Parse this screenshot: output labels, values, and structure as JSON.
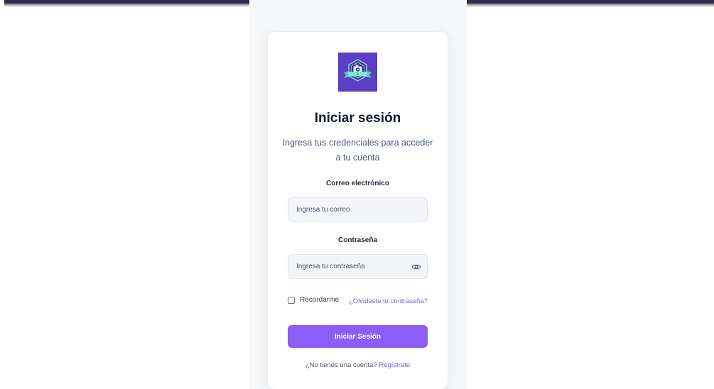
{
  "login": {
    "title": "Iniciar sesión",
    "subtitle": "Ingresa tus credenciales para acceder a tu cuenta",
    "email_label": "Correo electrónico",
    "email_placeholder": "Ingresa tu correo",
    "email_value": "",
    "password_label": "Contraseña",
    "password_placeholder": "Ingresa tu contraseña",
    "password_value": "",
    "remember_label": "Recordarme",
    "remember_checked": false,
    "forgot_link": "¿Olvidaste tu contraseña?",
    "submit_label": "Iniciar Sesión",
    "signup_prompt": "¿No tienes una cuenta?",
    "signup_link": "Regístrate",
    "icons": {
      "logo": "camera-badge-logo",
      "password_toggle": "eye-icon"
    }
  },
  "colors": {
    "accent": "#8b5cf6",
    "link": "#7c5ce8",
    "logo_bg": "#5b3fc4",
    "logo_ribbon": "#6ee7c8",
    "title": "#111827",
    "topbar": "#2b2a48"
  }
}
